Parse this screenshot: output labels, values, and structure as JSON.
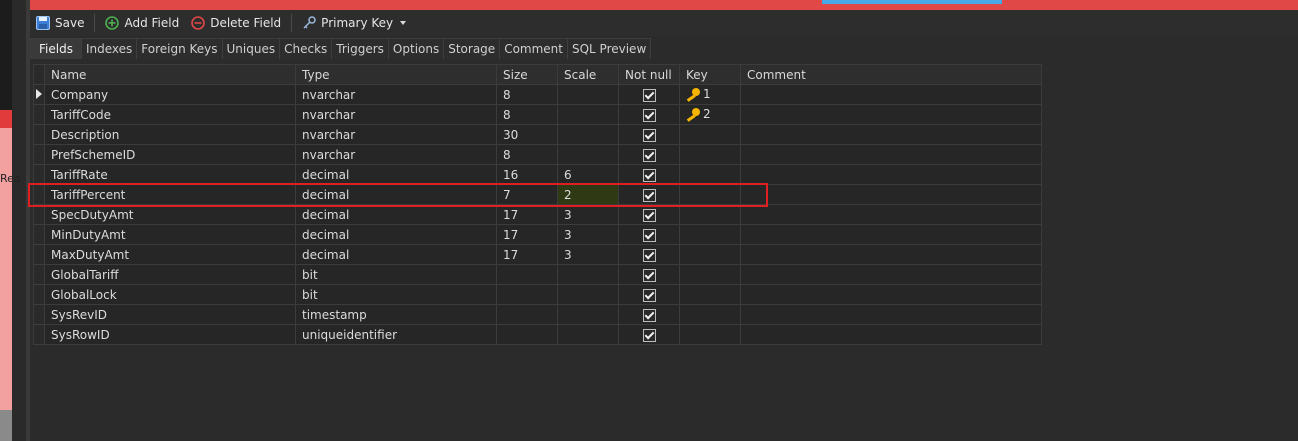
{
  "toolbar": {
    "save_label": "Save",
    "add_field_label": "Add Field",
    "delete_field_label": "Delete Field",
    "primary_key_label": "Primary Key"
  },
  "tabs": [
    {
      "label": "Fields",
      "active": true
    },
    {
      "label": "Indexes"
    },
    {
      "label": "Foreign Keys"
    },
    {
      "label": "Uniques"
    },
    {
      "label": "Checks"
    },
    {
      "label": "Triggers"
    },
    {
      "label": "Options"
    },
    {
      "label": "Storage"
    },
    {
      "label": "Comment"
    },
    {
      "label": "SQL Preview"
    }
  ],
  "left_panel": {
    "text": "Rea"
  },
  "grid": {
    "columns": [
      "Name",
      "Type",
      "Size",
      "Scale",
      "Not null",
      "Key",
      "Comment"
    ],
    "rows": [
      {
        "name": "Company",
        "type": "nvarchar",
        "size": "8",
        "scale": "",
        "not_null": true,
        "key": "1",
        "current": true
      },
      {
        "name": "TariffCode",
        "type": "nvarchar",
        "size": "8",
        "scale": "",
        "not_null": true,
        "key": "2"
      },
      {
        "name": "Description",
        "type": "nvarchar",
        "size": "30",
        "scale": "",
        "not_null": true,
        "key": ""
      },
      {
        "name": "PrefSchemeID",
        "type": "nvarchar",
        "size": "8",
        "scale": "",
        "not_null": true,
        "key": ""
      },
      {
        "name": "TariffRate",
        "type": "decimal",
        "size": "16",
        "scale": "6",
        "not_null": true,
        "key": ""
      },
      {
        "name": "TariffPercent",
        "type": "decimal",
        "size": "7",
        "scale": "2",
        "not_null": true,
        "key": "",
        "highlighted": true
      },
      {
        "name": "SpecDutyAmt",
        "type": "decimal",
        "size": "17",
        "scale": "3",
        "not_null": true,
        "key": ""
      },
      {
        "name": "MinDutyAmt",
        "type": "decimal",
        "size": "17",
        "scale": "3",
        "not_null": true,
        "key": ""
      },
      {
        "name": "MaxDutyAmt",
        "type": "decimal",
        "size": "17",
        "scale": "3",
        "not_null": true,
        "key": ""
      },
      {
        "name": "GlobalTariff",
        "type": "bit",
        "size": "",
        "scale": "",
        "not_null": true,
        "key": ""
      },
      {
        "name": "GlobalLock",
        "type": "bit",
        "size": "",
        "scale": "",
        "not_null": true,
        "key": ""
      },
      {
        "name": "SysRevID",
        "type": "timestamp",
        "size": "",
        "scale": "",
        "not_null": true,
        "key": ""
      },
      {
        "name": "SysRowID",
        "type": "uniqueidentifier",
        "size": "",
        "scale": "",
        "not_null": true,
        "key": ""
      }
    ]
  },
  "icons": {
    "save": "save-icon",
    "add": "add-circle-icon",
    "delete": "delete-circle-icon",
    "primary_key": "key-icon",
    "dropdown": "caret-down-icon",
    "row_key": "key-icon"
  },
  "colors": {
    "background": "#2b2b2b",
    "add_icon": "#4caf50",
    "delete_icon": "#e04848",
    "key_icon": "#f4b400",
    "highlight_border": "#e02020",
    "accent_tab": "#47a8e8"
  }
}
